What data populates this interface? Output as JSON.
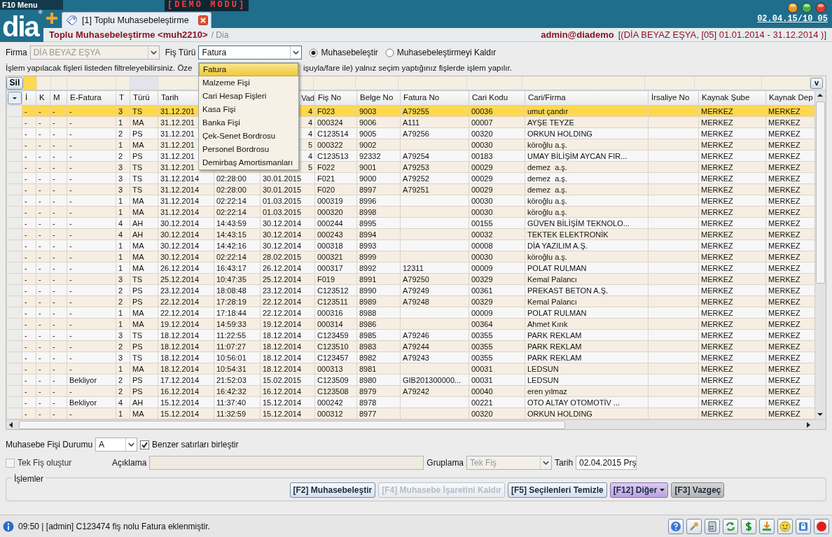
{
  "app": {
    "menu_label": "F10 Menu",
    "demo_label": "[DEMO MODU]",
    "logo": "dia",
    "logo_mark": "®",
    "clock": "02.04.15/10 05"
  },
  "tabs": [
    {
      "label": "[1] Toplu Muhasebeleştirme",
      "selected": true
    }
  ],
  "page_header": {
    "title": "Toplu Muhasebeleştirme <muh2210>",
    "breadcrumb": "/ Dia",
    "user": "admin@diademo",
    "context": "[(DİA BEYAZ EŞYA, [05] 01.01.2014 - 31.12.2014 )]"
  },
  "filters": {
    "firma": {
      "label": "Firma",
      "value": "DİA BEYAZ EŞYA",
      "disabled": true
    },
    "fis_turu": {
      "label": "Fiş Türü",
      "value": "Fatura",
      "expanded": true,
      "options": [
        {
          "label": "Fatura",
          "selected": true
        },
        {
          "label": "Malzeme Fişi",
          "selected": false
        },
        {
          "label": "Cari Hesap Fişleri",
          "selected": false
        },
        {
          "label": "Kasa Fişi",
          "selected": false
        },
        {
          "label": "Banka Fişi",
          "selected": false
        },
        {
          "label": "Çek-Senet Bordrosu",
          "selected": false
        },
        {
          "label": "Personel Bordrosu",
          "selected": false
        },
        {
          "label": "Demirbaş Amortismanları",
          "selected": false
        }
      ]
    },
    "modes": [
      {
        "label": "Muhasebeleştir",
        "selected": true
      },
      {
        "label": "Muhasebeleştirmeyi Kaldır",
        "selected": false
      }
    ]
  },
  "grid": {
    "legend_left": "İşlem yapılacak fişleri listeden filtreleyebilirsiniz. Öze",
    "legend_right": "işuyla/fare ile) yalnız seçim yaptığınız fişlerde işlem yapılır.",
    "delete_button": "Sil",
    "filter_toggle": "v",
    "columns": [
      "İ",
      "K",
      "M",
      "E-Fatura",
      "T",
      "Türü",
      "Tarih",
      null,
      "Vad",
      "Fiş No",
      "Belge No",
      "Fatura No",
      "Cari Kodu",
      "Cari/Firma",
      "İrsaliye No",
      "Kaynak Şube",
      "Kaynak Dep"
    ],
    "rows": [
      {
        "selected": true,
        "under_menu": true,
        "cells": [
          "-",
          "-",
          "-",
          "-",
          "3",
          "TS",
          "31.12.201",
          null,
          "4",
          "F023",
          "9003",
          "A79255",
          "00036",
          "umut çandır",
          null,
          "MERKEZ",
          "MERKEZ"
        ]
      },
      {
        "selected": false,
        "under_menu": true,
        "cells": [
          "-",
          "-",
          "-",
          "-",
          "1",
          "MA",
          "31.12.201",
          null,
          "4",
          "000324",
          "9006",
          "A111",
          "00007",
          "AYŞE TEYZE",
          null,
          "MERKEZ",
          "MERKEZ"
        ]
      },
      {
        "selected": false,
        "under_menu": true,
        "cells": [
          "-",
          "-",
          "-",
          "-",
          "2",
          "PS",
          "31.12.201",
          null,
          "4",
          "C123514",
          "9005",
          "A79256",
          "00320",
          "ORKUN HOLDING",
          null,
          "MERKEZ",
          "MERKEZ"
        ]
      },
      {
        "selected": false,
        "under_menu": true,
        "cells": [
          "-",
          "-",
          "-",
          "-",
          "1",
          "MA",
          "31.12.201",
          null,
          "5",
          "000322",
          "9002",
          null,
          "00030",
          "köroğlu a.ş.",
          null,
          "MERKEZ",
          "MERKEZ"
        ]
      },
      {
        "selected": false,
        "under_menu": true,
        "cells": [
          "-",
          "-",
          "-",
          "-",
          "2",
          "PS",
          "31.12.201",
          null,
          "4",
          "C123513",
          "92332",
          "A79254",
          "00183",
          "UMAY BİLİŞİM AYCAN FIR...",
          null,
          "MERKEZ",
          "MERKEZ"
        ]
      },
      {
        "selected": false,
        "under_menu": true,
        "cells": [
          "-",
          "-",
          "-",
          "-",
          "3",
          "TS",
          "31.12.201",
          null,
          "5",
          "F022",
          "9001",
          "A79253",
          "00029",
          "demez  a.ş.",
          null,
          "MERKEZ",
          "MERKEZ"
        ]
      },
      {
        "selected": false,
        "under_menu": false,
        "cells": [
          "-",
          "-",
          "-",
          "-",
          "3",
          "TS",
          "31.12.2014",
          "02:28:00",
          "30.01.2015",
          "F021",
          "9000",
          "A79252",
          "00029",
          "demez  a.ş.",
          null,
          "MERKEZ",
          "MERKEZ"
        ]
      },
      {
        "selected": false,
        "under_menu": false,
        "cells": [
          "-",
          "-",
          "-",
          "-",
          "3",
          "TS",
          "31.12.2014",
          "02:28:00",
          "30.01.2015",
          "F020",
          "8997",
          "A79251",
          "00029",
          "demez  a.ş.",
          null,
          "MERKEZ",
          "MERKEZ"
        ]
      },
      {
        "selected": false,
        "under_menu": false,
        "cells": [
          "-",
          "-",
          "-",
          "-",
          "1",
          "MA",
          "31.12.2014",
          "02:22:14",
          "01.03.2015",
          "000319",
          "8996",
          null,
          "00030",
          "köroğlu a.ş.",
          null,
          "MERKEZ",
          "MERKEZ"
        ]
      },
      {
        "selected": false,
        "under_menu": false,
        "cells": [
          "-",
          "-",
          "-",
          "-",
          "1",
          "MA",
          "31.12.2014",
          "02:22:14",
          "01.03.2015",
          "000320",
          "8998",
          null,
          "00030",
          "köroğlu a.ş.",
          null,
          "MERKEZ",
          "MERKEZ"
        ]
      },
      {
        "selected": false,
        "under_menu": false,
        "cells": [
          "-",
          "-",
          "-",
          "-",
          "4",
          "AH",
          "30.12.2014",
          "14:43:59",
          "30.12.2014",
          "000244",
          "8995",
          null,
          "00155",
          "GÜVEN BİLİŞİM TEKNOLO...",
          null,
          "MERKEZ",
          "MERKEZ"
        ]
      },
      {
        "selected": false,
        "under_menu": false,
        "cells": [
          "-",
          "-",
          "-",
          "-",
          "4",
          "AH",
          "30.12.2014",
          "14:43:15",
          "30.12.2014",
          "000243",
          "8994",
          null,
          "00032",
          "TEKTEK ELEKTRONİK",
          null,
          "MERKEZ",
          "MERKEZ"
        ]
      },
      {
        "selected": false,
        "under_menu": false,
        "cells": [
          "-",
          "-",
          "-",
          "-",
          "1",
          "MA",
          "30.12.2014",
          "14:42:16",
          "30.12.2014",
          "000318",
          "8993",
          null,
          "00008",
          "DİA YAZILIM A.Ş.",
          null,
          "MERKEZ",
          "MERKEZ"
        ]
      },
      {
        "selected": false,
        "under_menu": false,
        "cells": [
          "-",
          "-",
          "-",
          "-",
          "1",
          "MA",
          "30.12.2014",
          "02:22:14",
          "28.02.2015",
          "000321",
          "8999",
          null,
          "00030",
          "köroğlu a.ş.",
          null,
          "MERKEZ",
          "MERKEZ"
        ]
      },
      {
        "selected": false,
        "under_menu": false,
        "cells": [
          "-",
          "-",
          "-",
          "-",
          "1",
          "MA",
          "26.12.2014",
          "16:43:17",
          "26.12.2014",
          "000317",
          "8992",
          "12311",
          "00009",
          "POLAT RULMAN",
          null,
          "MERKEZ",
          "MERKEZ"
        ]
      },
      {
        "selected": false,
        "under_menu": false,
        "cells": [
          "-",
          "-",
          "-",
          "-",
          "3",
          "TS",
          "25.12.2014",
          "10:47:35",
          "25.12.2014",
          "F019",
          "8991",
          "A79250",
          "00329",
          "Kemal Palancı",
          null,
          "MERKEZ",
          "MERKEZ"
        ]
      },
      {
        "selected": false,
        "under_menu": false,
        "cells": [
          "-",
          "-",
          "-",
          "-",
          "2",
          "PS",
          "23.12.2014",
          "18:08:48",
          "23.12.2014",
          "C123512",
          "8990",
          "A79249",
          "00361",
          "PREKAST BETON A.Ş.",
          null,
          "MERKEZ",
          "MERKEZ"
        ]
      },
      {
        "selected": false,
        "under_menu": false,
        "cells": [
          "-",
          "-",
          "-",
          "-",
          "2",
          "PS",
          "22.12.2014",
          "17:28:19",
          "22.12.2014",
          "C123511",
          "8989",
          "A79248",
          "00329",
          "Kemal Palancı",
          null,
          "MERKEZ",
          "MERKEZ"
        ]
      },
      {
        "selected": false,
        "under_menu": false,
        "cells": [
          "-",
          "-",
          "-",
          "-",
          "1",
          "MA",
          "22.12.2014",
          "17:18:44",
          "22.12.2014",
          "000316",
          "8988",
          null,
          "00009",
          "POLAT RULMAN",
          null,
          "MERKEZ",
          "MERKEZ"
        ]
      },
      {
        "selected": false,
        "under_menu": false,
        "cells": [
          "-",
          "-",
          "-",
          "-",
          "1",
          "MA",
          "19.12.2014",
          "14:59:33",
          "19.12.2014",
          "000314",
          "8986",
          null,
          "00364",
          "Ahmet Kırık",
          null,
          "MERKEZ",
          "MERKEZ"
        ]
      },
      {
        "selected": false,
        "under_menu": false,
        "cells": [
          "-",
          "-",
          "-",
          "-",
          "3",
          "TS",
          "18.12.2014",
          "11:22:55",
          "18.12.2014",
          "C123459",
          "8985",
          "A79246",
          "00355",
          "PARK REKLAM",
          null,
          "MERKEZ",
          "MERKEZ"
        ]
      },
      {
        "selected": false,
        "under_menu": false,
        "cells": [
          "-",
          "-",
          "-",
          "-",
          "2",
          "PS",
          "18.12.2014",
          "11:07:27",
          "18.12.2014",
          "C123510",
          "8983",
          "A79244",
          "00355",
          "PARK REKLAM",
          null,
          "MERKEZ",
          "MERKEZ"
        ]
      },
      {
        "selected": false,
        "under_menu": false,
        "cells": [
          "-",
          "-",
          "-",
          "-",
          "3",
          "TS",
          "18.12.2014",
          "10:56:01",
          "18.12.2014",
          "C123457",
          "8982",
          "A79243",
          "00355",
          "PARK REKLAM",
          null,
          "MERKEZ",
          "MERKEZ"
        ]
      },
      {
        "selected": false,
        "under_menu": false,
        "cells": [
          "-",
          "-",
          "-",
          "-",
          "1",
          "MA",
          "18.12.2014",
          "10:54:31",
          "18.12.2014",
          "000313",
          "8981",
          null,
          "00031",
          "LEDSUN",
          null,
          "MERKEZ",
          "MERKEZ"
        ]
      },
      {
        "selected": false,
        "under_menu": false,
        "cells": [
          "-",
          "-",
          "-",
          "Bekliyor",
          "2",
          "PS",
          "17.12.2014",
          "21:52:03",
          "15.02.2015",
          "C123509",
          "8980",
          "GIB201300000...",
          "00031",
          "LEDSUN",
          null,
          "MERKEZ",
          "MERKEZ"
        ]
      },
      {
        "selected": false,
        "under_menu": false,
        "cells": [
          "-",
          "-",
          "-",
          "-",
          "2",
          "PS",
          "16.12.2014",
          "16:42:32",
          "16.12.2014",
          "C123508",
          "8979",
          "A79242",
          "00040",
          "eren yılmaz",
          null,
          "MERKEZ",
          "MERKEZ"
        ]
      },
      {
        "selected": false,
        "under_menu": false,
        "cells": [
          "-",
          "-",
          "-",
          "Bekliyor",
          "4",
          "AH",
          "15.12.2014",
          "11:37:40",
          "15.12.2014",
          "000242",
          "8978",
          null,
          "00221",
          "OTO ALTAY OTOMOTİV ...",
          null,
          "MERKEZ",
          "MERKEZ"
        ]
      },
      {
        "selected": false,
        "under_menu": false,
        "cells": [
          "-",
          "-",
          "-",
          "-",
          "1",
          "MA",
          "15.12.2014",
          "11:32:59",
          "15.12.2014",
          "000312",
          "8977",
          null,
          "00320",
          "ORKUN HOLDING",
          null,
          "MERKEZ",
          "MERKEZ"
        ]
      }
    ]
  },
  "options": {
    "status_label": "Muhasebe Fişi Durumu",
    "status_value": "A",
    "merge": {
      "label": "Benzer satırları birleştir",
      "checked": true
    },
    "single": {
      "label": "Tek Fiş oluştur",
      "checked": false
    },
    "description_label": "Açıklama",
    "grouping_label": "Gruplama",
    "grouping_value": "Tek Fiş",
    "grouping_disabled": true,
    "date_label": "Tarih",
    "date_value": "02.04.2015 Prş"
  },
  "actions": {
    "legend": "İşlemler",
    "buttons": [
      {
        "label": "[F2] Muhasebeleştir",
        "kind": "normal",
        "disabled": false
      },
      {
        "label": "[F4] Muhasebe İşaretini Kaldır",
        "kind": "normal",
        "disabled": true
      },
      {
        "label": "[F5] Seçilenleri Temizle",
        "kind": "normal",
        "disabled": false
      },
      {
        "label": "[F12] Diğer",
        "kind": "menu",
        "disabled": false
      },
      {
        "label": "[F3] Vazgeç",
        "kind": "cancel",
        "disabled": false
      }
    ]
  },
  "status_bar": {
    "message": "09:50 | [admin] C123474 fiş nolu Fatura eklenmiştir."
  }
}
